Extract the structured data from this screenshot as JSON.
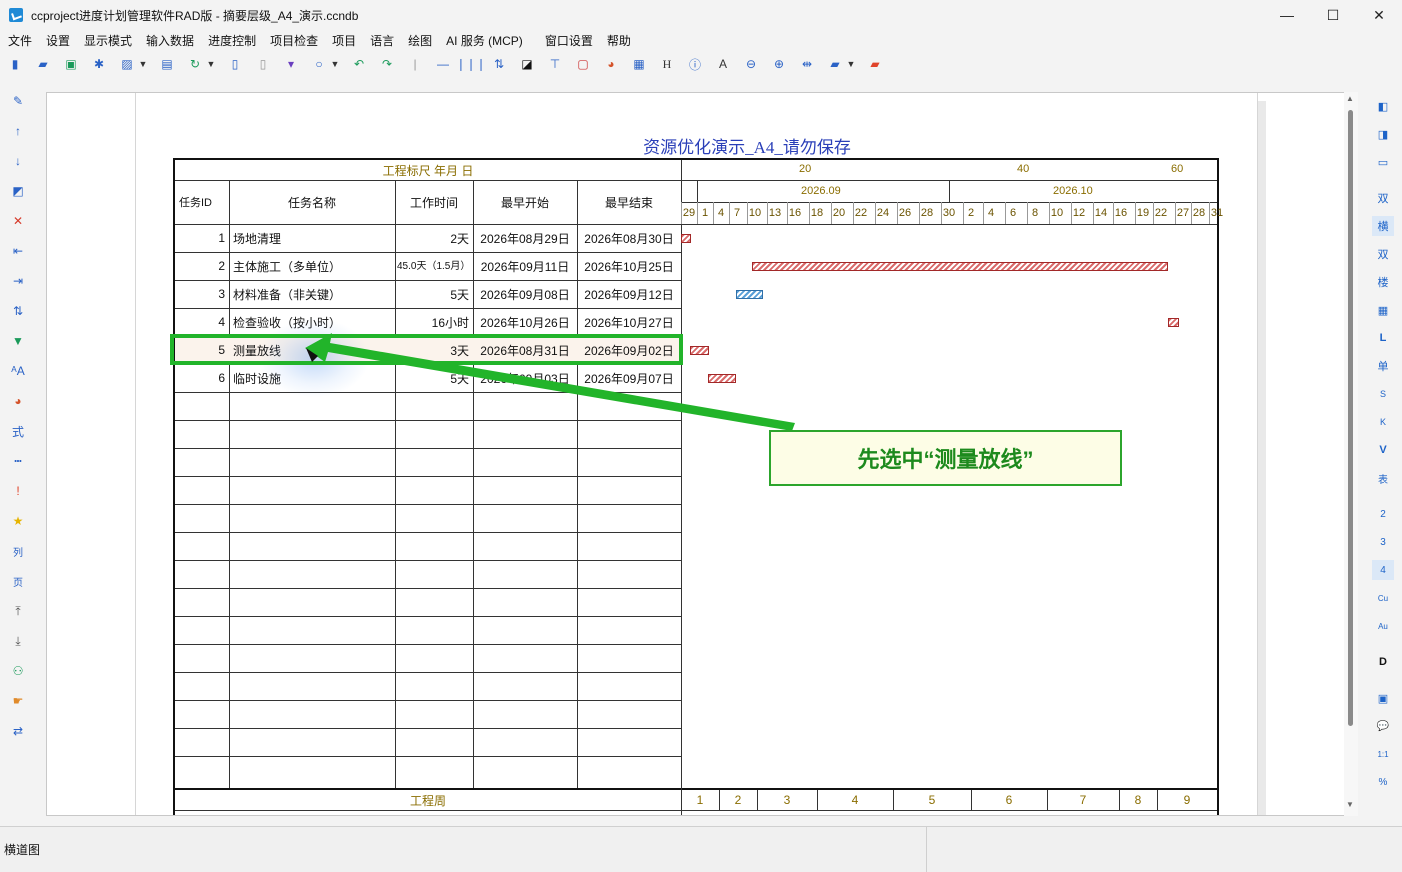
{
  "window": {
    "title": "ccproject进度计划管理软件RAD版 - 摘要层级_A4_演示.ccndb",
    "minimize": "—",
    "maximize": "☐",
    "close": "✕"
  },
  "menu": [
    "文件",
    "设置",
    "显示模式",
    "输入数据",
    "进度控制",
    "项目检查",
    "项目",
    "语言",
    "绘图",
    "AI 服务 (MCP)",
    "窗口设置",
    "帮助"
  ],
  "toolbar_icons": [
    "new-icon",
    "open-folder-icon",
    "save-icon",
    "asterisk-icon",
    "export-icon",
    "dropdown-icon",
    "print-icon",
    "refresh-icon",
    "dropdown-icon",
    "clipboard-icon",
    "paste-icon",
    "format-brush-icon",
    "search-icon",
    "dropdown-icon",
    "undo-icon",
    "redo-icon",
    "separator-icon",
    "line-icon",
    "columns-icon",
    "sort-icon",
    "contrast-icon",
    "stamp-icon",
    "document-icon",
    "palette-icon",
    "edit-document-icon",
    "letter-h-icon",
    "info-icon",
    "letter-a-icon",
    "zoom-out-icon",
    "zoom-in-icon",
    "arrows-icon",
    "folder-icon",
    "dropdown-icon",
    "red-folder-icon"
  ],
  "document": {
    "title": "资源优化演示_A4_请勿保存",
    "ruler_label": "工程标尺 年月 日",
    "ruler_ticks": [
      "20",
      "40",
      "60"
    ],
    "months": [
      "2026.09",
      "2026.10"
    ],
    "days": [
      "29",
      "1",
      "4",
      "7",
      "10",
      "13",
      "16",
      "18",
      "20",
      "22",
      "24",
      "26",
      "28",
      "30",
      "2",
      "4",
      "6",
      "8",
      "10",
      "12",
      "14",
      "16",
      "19",
      "22",
      "27",
      "28",
      "31"
    ],
    "columns": [
      "任务ID",
      "任务名称",
      "工作时间",
      "最早开始",
      "最早结束"
    ],
    "rows": [
      {
        "id": "1",
        "name": "场地清理",
        "duration": "2天",
        "start": "2026年08月29日",
        "end": "2026年08月30日"
      },
      {
        "id": "2",
        "name": "主体施工（多单位）",
        "duration": "45.0天（1.5月）",
        "start": "2026年09月11日",
        "end": "2026年10月25日"
      },
      {
        "id": "3",
        "name": "材料准备（非关键）",
        "duration": "5天",
        "start": "2026年09月08日",
        "end": "2026年09月12日"
      },
      {
        "id": "4",
        "name": "检查验收（按小时）",
        "duration": "16小时",
        "start": "2026年10月26日",
        "end": "2026年10月27日"
      },
      {
        "id": "5",
        "name": "测量放线",
        "duration": "3天",
        "start": "2026年08月31日",
        "end": "2026年09月02日"
      },
      {
        "id": "6",
        "name": "临时设施",
        "duration": "5天",
        "start": "2026年09月03日",
        "end": "2026年09月07日"
      }
    ],
    "footer_label": "工程周",
    "weeks": [
      "1",
      "2",
      "3",
      "4",
      "5",
      "6",
      "7",
      "8",
      "9"
    ],
    "callout": "先选中“测量放线”"
  },
  "left_toolbar_icons": [
    "pencil-icon",
    "arrow-up-icon",
    "arrow-down-icon",
    "edit-icon",
    "delete-icon",
    "indent-left-icon",
    "indent-right-icon",
    "swap-vertical-icon",
    "filter-icon",
    "font-size-icon",
    "palette-icon",
    "formula-icon",
    "dotted-line-icon",
    "exclamation-icon",
    "star-icon",
    "column-icon",
    "page-icon",
    "move-top-icon",
    "move-bottom-icon",
    "users-icon",
    "hand-point-icon",
    "swap-horizontal-icon"
  ],
  "left_toolbar_labels": {
    "formula": "式",
    "column": "列",
    "page": "页"
  },
  "right_toolbar": [
    "◧",
    "◨",
    "▭",
    "双",
    "横",
    "双",
    "楼",
    "▦",
    "L",
    "单",
    "S",
    "K",
    "V",
    "表",
    "2",
    "3",
    "4",
    "Cu",
    "Au",
    "D",
    "▣",
    "💬",
    "1:1",
    "%"
  ],
  "status": {
    "left": "横道图"
  }
}
